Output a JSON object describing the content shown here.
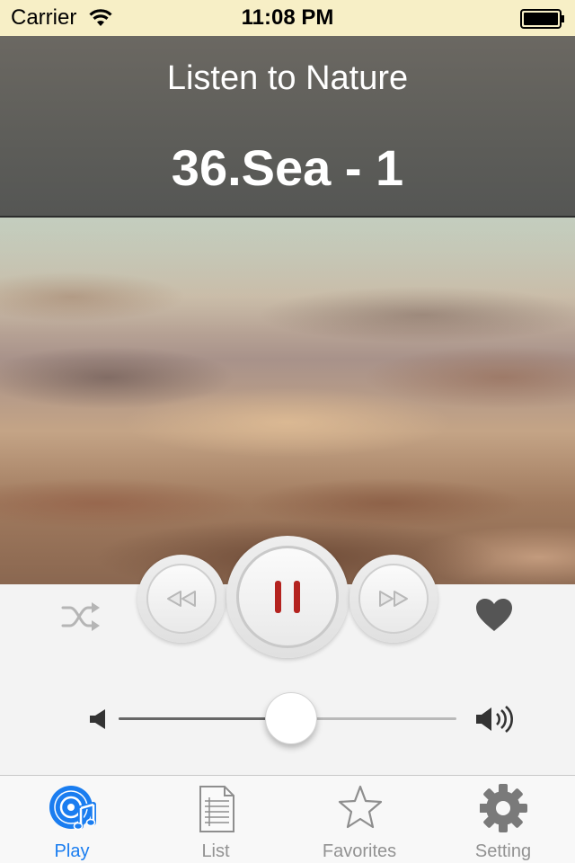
{
  "status_bar": {
    "carrier": "Carrier",
    "time": "11:08 PM",
    "icons": [
      "wifi-icon",
      "battery-icon"
    ]
  },
  "header": {
    "app_title": "Listen to Nature",
    "track_title": "36.Sea - 1"
  },
  "controls": {
    "shuffle_icon": "shuffle-icon",
    "rewind_icon": "rewind-icon",
    "play_state": "playing",
    "pause_icon": "pause-icon",
    "forward_icon": "fast-forward-icon",
    "favorite_icon": "heart-icon",
    "volume_level": 0.51
  },
  "tab_bar": {
    "items": [
      {
        "label": "Play",
        "icon": "music-disc-icon",
        "active": true
      },
      {
        "label": "List",
        "icon": "document-list-icon",
        "active": false
      },
      {
        "label": "Favorites",
        "icon": "star-icon",
        "active": false
      },
      {
        "label": "Setting",
        "icon": "gear-icon",
        "active": false
      }
    ]
  },
  "colors": {
    "status_bar_bg": "#f7efc6",
    "header_bg": "#5d5d59",
    "accent": "#1a7df0",
    "pause_red": "#b4231f",
    "inactive": "#929292"
  }
}
